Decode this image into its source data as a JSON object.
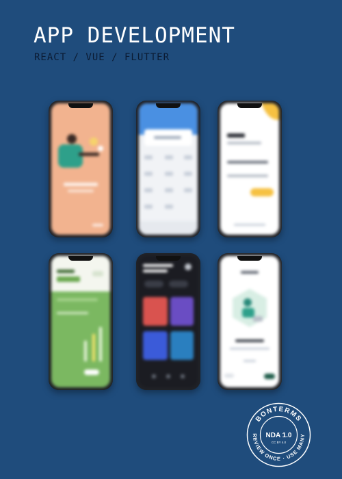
{
  "header": {
    "title": "APP DEVELOPMENT",
    "subtitle": "REACT / VUE / FLUTTER"
  },
  "badge": {
    "top_text": "BONTERMS",
    "center_text": "NDA 1.0",
    "license_text": "CC BY 4.0",
    "bottom_text": "REVIEW ONCE · USE MANY"
  },
  "colors": {
    "background": "#1f4c7c",
    "title": "#ffffff",
    "subtitle": "#0b1b33",
    "accent_yellow": "#f6c142",
    "accent_blue": "#4a90e2",
    "accent_green": "#7bb861"
  },
  "phones": [
    {
      "name": "onboarding",
      "bg": "#f2b38f"
    },
    {
      "name": "dashboard",
      "bg": "#f1f3f6"
    },
    {
      "name": "login",
      "bg": "#ffffff"
    },
    {
      "name": "stats",
      "bg": "#7bb861"
    },
    {
      "name": "music",
      "bg": "#1b1c22"
    },
    {
      "name": "illustration",
      "bg": "#ffffff"
    }
  ]
}
